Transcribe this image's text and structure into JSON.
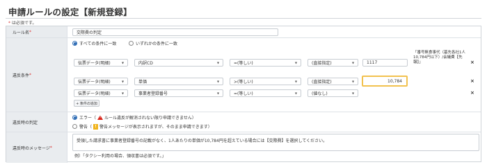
{
  "page": {
    "title": "申請ルールの設定【新規登録】",
    "required_note": "は必須です。",
    "required_star": "*"
  },
  "rule_name": {
    "label": "ルール名",
    "value": "交際費の判定"
  },
  "conditions": {
    "label": "違反条件",
    "match_all": "すべての条件に一致",
    "match_any": "いずれかの条件に一致",
    "rows": [
      {
        "source": "伝票データ(明細)",
        "field": "内訳CD",
        "operator": "=(等しい)",
        "mode": "(直接指定)",
        "value": "1117",
        "hint": "「番号無食事代（基先各社1人10,784円以下）/会議費【先報】」"
      },
      {
        "source": "伝票データ(明細)",
        "field": "単価",
        "operator": ">(等しい)",
        "mode": "(直接指定)",
        "value": "10,784",
        "hint": ""
      },
      {
        "source": "伝票データ(明細)",
        "field": "事業者登録番号",
        "operator": "=(等しい)",
        "mode": "(値なし)",
        "value": "",
        "hint": ""
      }
    ],
    "add_button": "+ 条件の追加",
    "remove_icon": "×"
  },
  "judgement": {
    "label": "違反時の判定",
    "error_label": "エラー",
    "error_desc": "ルール違反が解消されない限り申請できません",
    "warning_label": "警告",
    "warning_desc": "警告メッセージが表示されますが、そのまま申請できます",
    "open_paren": "（",
    "close_paren": "）",
    "warning_glyph": "!"
  },
  "message": {
    "label": "違反時のメッセージ",
    "value": "受領した請求書に事業者登録番号の記載がなく、1人あたりの単価が10,784円を超えている場合には【交際費】を選択してください。",
    "example": "例）「タクシー利用の場合、領収書は必須です。」"
  }
}
